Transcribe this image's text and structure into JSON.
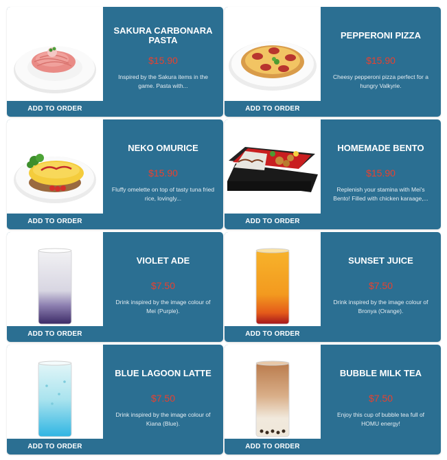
{
  "colors": {
    "card_bg": "#2b6f92",
    "price": "#e8412f",
    "text": "#ffffff"
  },
  "menu_items": [
    {
      "name": "SAKURA CARBONARA PASTA",
      "price": "$15.90",
      "description": "Inspired by the Sakura items in the game. Pasta with...",
      "button_label": "ADD TO ORDER",
      "image": "pink-pasta-plate"
    },
    {
      "name": "PEPPERONI PIZZA",
      "price": "$15.90",
      "description": "Cheesy pepperoni pizza perfect for a hungry Valkyrie.",
      "button_label": "ADD TO ORDER",
      "image": "pepperoni-pizza"
    },
    {
      "name": "NEKO OMURICE",
      "price": "$15.90",
      "description": "Fluffy omelette on top of tasty tuna fried rice, lovingly...",
      "button_label": "ADD TO ORDER",
      "image": "omurice-plate"
    },
    {
      "name": "HOMEMADE BENTO",
      "price": "$15.90",
      "description": "Replenish your stamina with Mei's Bento! Filled with chicken karaage,...",
      "button_label": "ADD TO ORDER",
      "image": "bento-box"
    },
    {
      "name": "VIOLET ADE",
      "price": "$7.50",
      "description": "Drink inspired by the image colour of Mei (Purple).",
      "button_label": "ADD TO ORDER",
      "image": "purple-drink-glass"
    },
    {
      "name": "SUNSET JUICE",
      "price": "$7.50",
      "description": "Drink inspired by the image colour of Bronya (Orange).",
      "button_label": "ADD TO ORDER",
      "image": "orange-drink-glass"
    },
    {
      "name": "BLUE LAGOON LATTE",
      "price": "$7.50",
      "description": "Drink inspired by the image colour of Kiana (Blue).",
      "button_label": "ADD TO ORDER",
      "image": "blue-drink-glass"
    },
    {
      "name": "BUBBLE MILK TEA",
      "price": "$7.50",
      "description": "Enjoy this cup of bubble tea full of HOMU energy!",
      "button_label": "ADD TO ORDER",
      "image": "milk-tea-glass"
    }
  ]
}
